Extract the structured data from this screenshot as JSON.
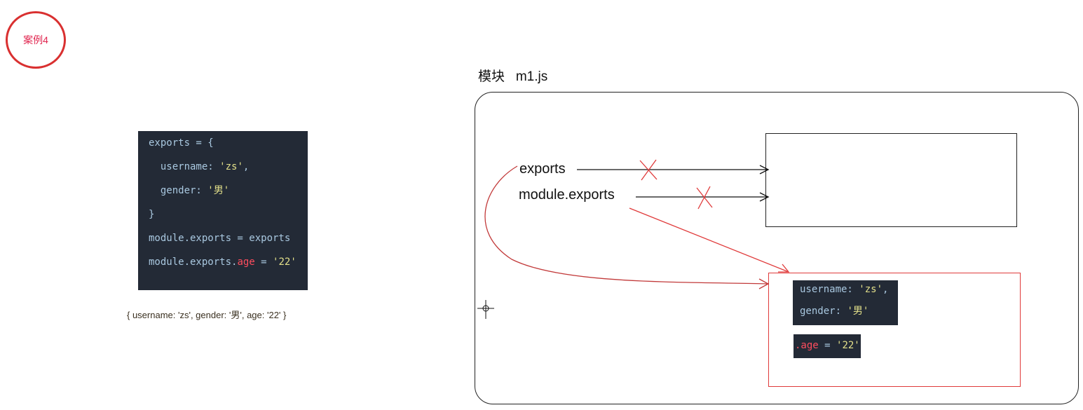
{
  "badge": {
    "label": "案例4",
    "color": "#d93030"
  },
  "left_code": {
    "lines": [
      {
        "parts": [
          {
            "t": "exports = {",
            "c": "plain"
          }
        ]
      },
      {
        "parts": [
          {
            "t": "  username: ",
            "c": "plain"
          },
          {
            "t": "'zs'",
            "c": "str"
          },
          {
            "t": ",",
            "c": "plain"
          }
        ]
      },
      {
        "parts": [
          {
            "t": "  gender: ",
            "c": "plain"
          },
          {
            "t": "'男'",
            "c": "str"
          }
        ]
      },
      {
        "parts": [
          {
            "t": "}",
            "c": "plain"
          }
        ]
      },
      {
        "parts": [
          {
            "t": "module.exports = exports",
            "c": "plain"
          }
        ]
      },
      {
        "parts": [
          {
            "t": "module.exports.",
            "c": "plain"
          },
          {
            "t": "age",
            "c": "kw-red"
          },
          {
            "t": " = ",
            "c": "plain"
          },
          {
            "t": "'22'",
            "c": "str"
          }
        ]
      }
    ]
  },
  "result_text": "{ username: 'zs', gender: '男', age: '22' }",
  "module": {
    "title": "模块   m1.js",
    "exports_label": "exports",
    "module_exports_label": "module.exports"
  },
  "object_code": {
    "lines": [
      {
        "parts": [
          {
            "t": "username: ",
            "c": "plain"
          },
          {
            "t": "'zs'",
            "c": "str"
          },
          {
            "t": ",",
            "c": "plain"
          }
        ]
      },
      {
        "parts": [
          {
            "t": "gender: ",
            "c": "plain"
          },
          {
            "t": "'男'",
            "c": "str"
          }
        ]
      }
    ]
  },
  "age_code": {
    "lines": [
      {
        "parts": [
          {
            "t": ".age",
            "c": "kw-red"
          },
          {
            "t": " = ",
            "c": "plain"
          },
          {
            "t": "'22'",
            "c": "str"
          }
        ]
      }
    ]
  },
  "colors": {
    "code_bg": "#232a36",
    "string": "#e3e08a",
    "keyword_red": "#ff4d5e",
    "annotation_red": "#e03a3a"
  }
}
